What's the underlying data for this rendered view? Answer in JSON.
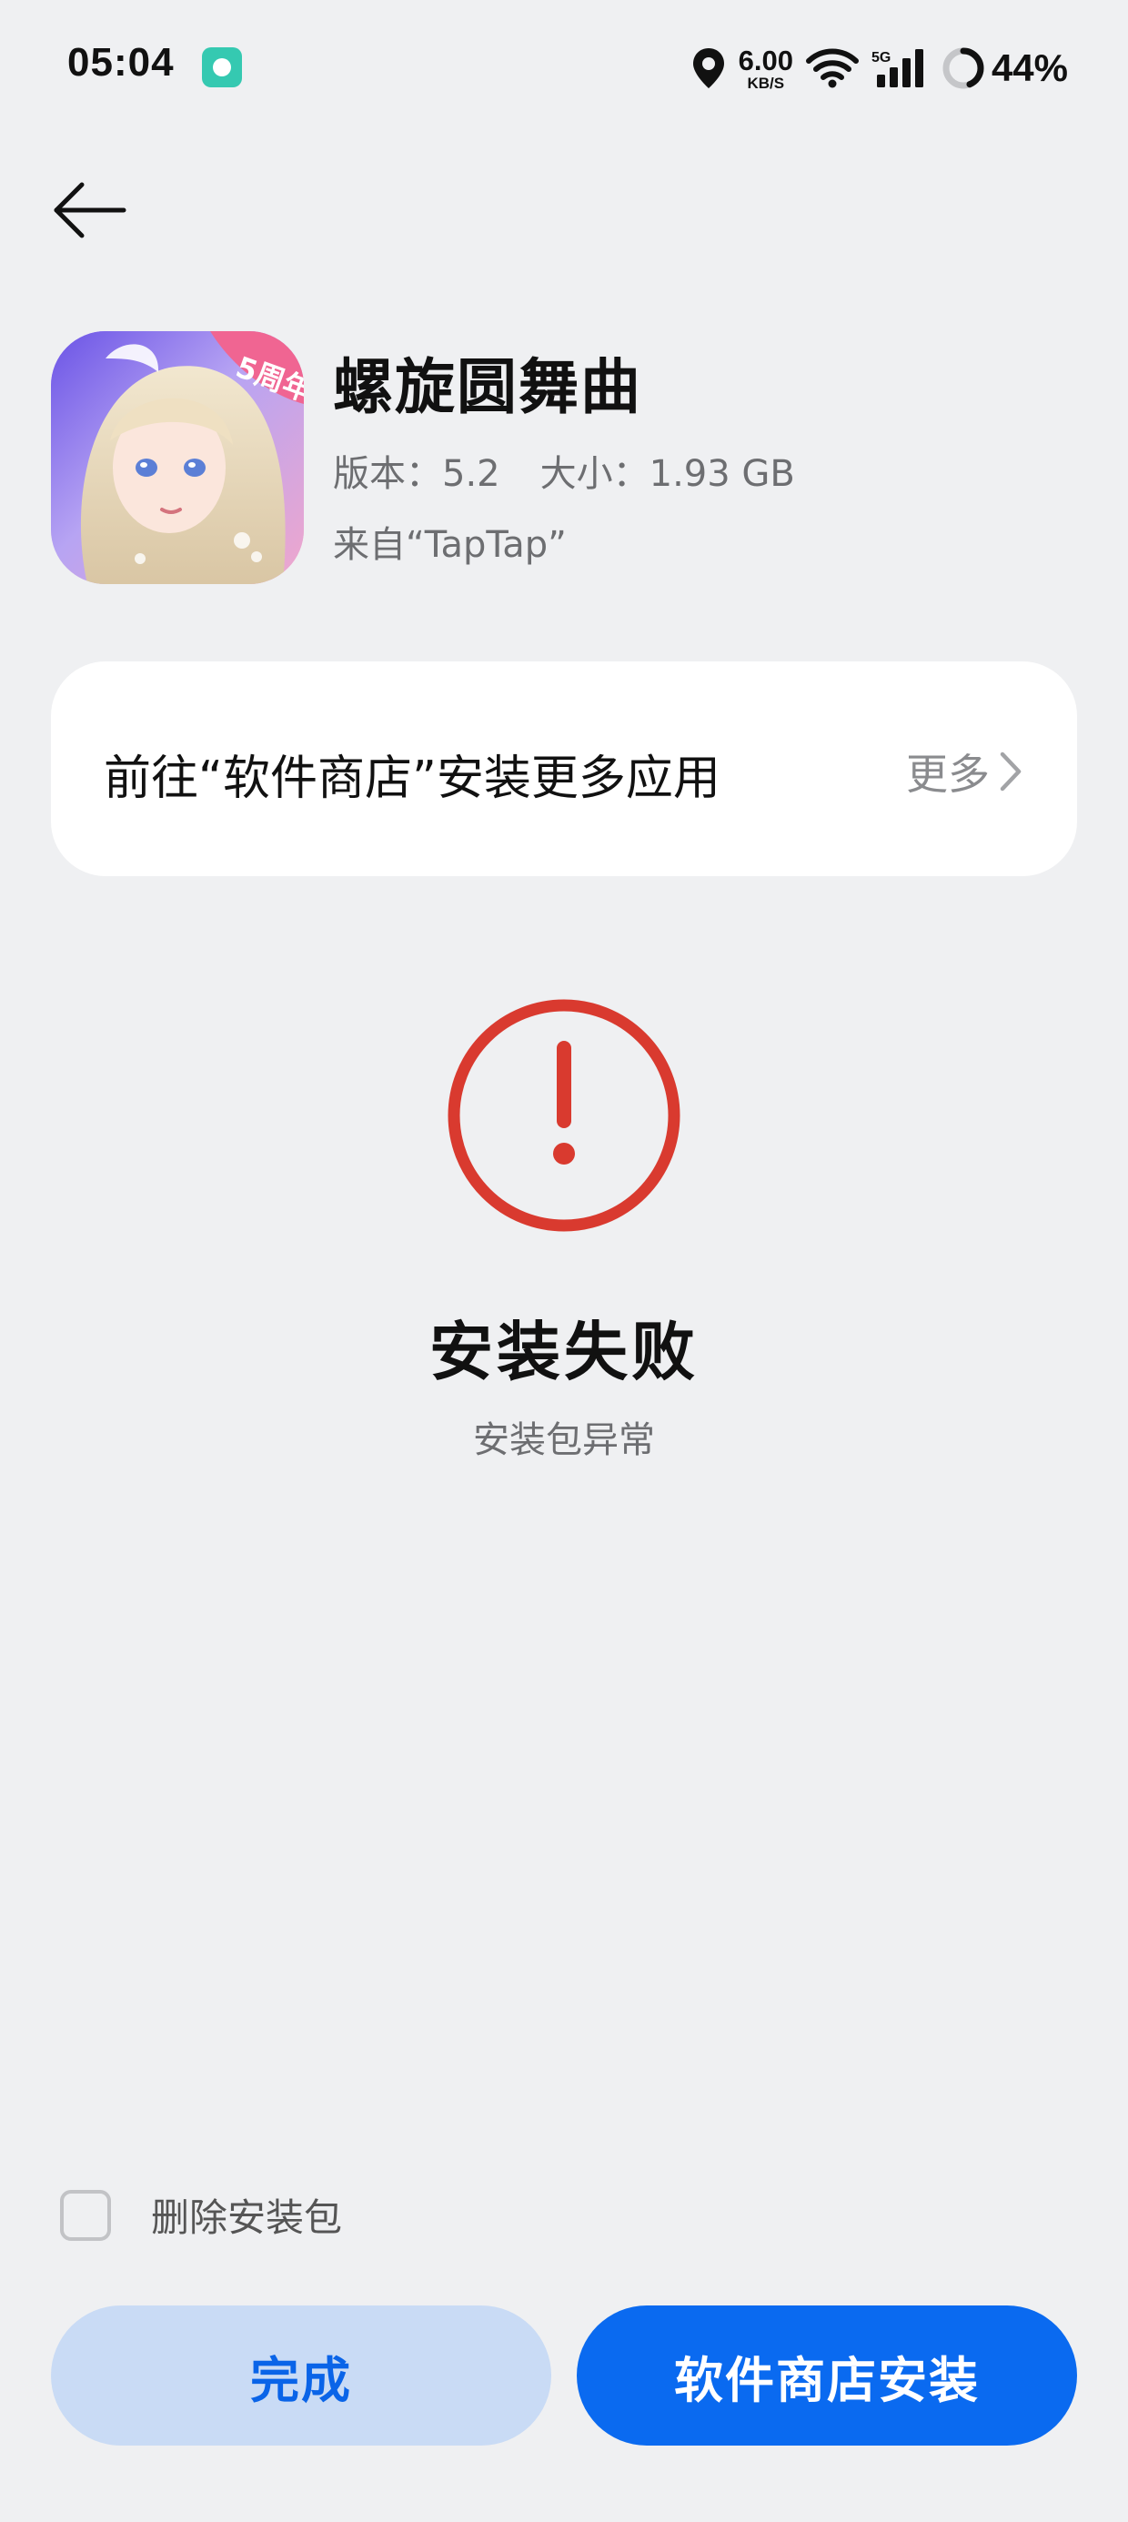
{
  "status_bar": {
    "time": "05:04",
    "net_speed_value": "6.00",
    "net_speed_unit": "KB/S",
    "signal_label": "5G",
    "battery_percent": "44%",
    "battery_level": 0.44
  },
  "app": {
    "name": "螺旋圆舞曲",
    "version": "版本：5.2",
    "size": "大小：1.93 GB",
    "source": "来自“TapTap”",
    "icon_badge": "5周年"
  },
  "store_card": {
    "label": "前往“软件商店”安装更多应用",
    "more": "更多"
  },
  "result": {
    "title": "安装失败",
    "subtitle": "安装包异常"
  },
  "options": {
    "delete_package_label": "删除安装包",
    "delete_package_checked": false
  },
  "buttons": {
    "done": "完成",
    "store_install": "软件商店安装"
  },
  "colors": {
    "background": "#eff0f2",
    "error": "#d93a2f",
    "primary": "#0a6af0",
    "secondary_button": "#c9dbf5"
  }
}
